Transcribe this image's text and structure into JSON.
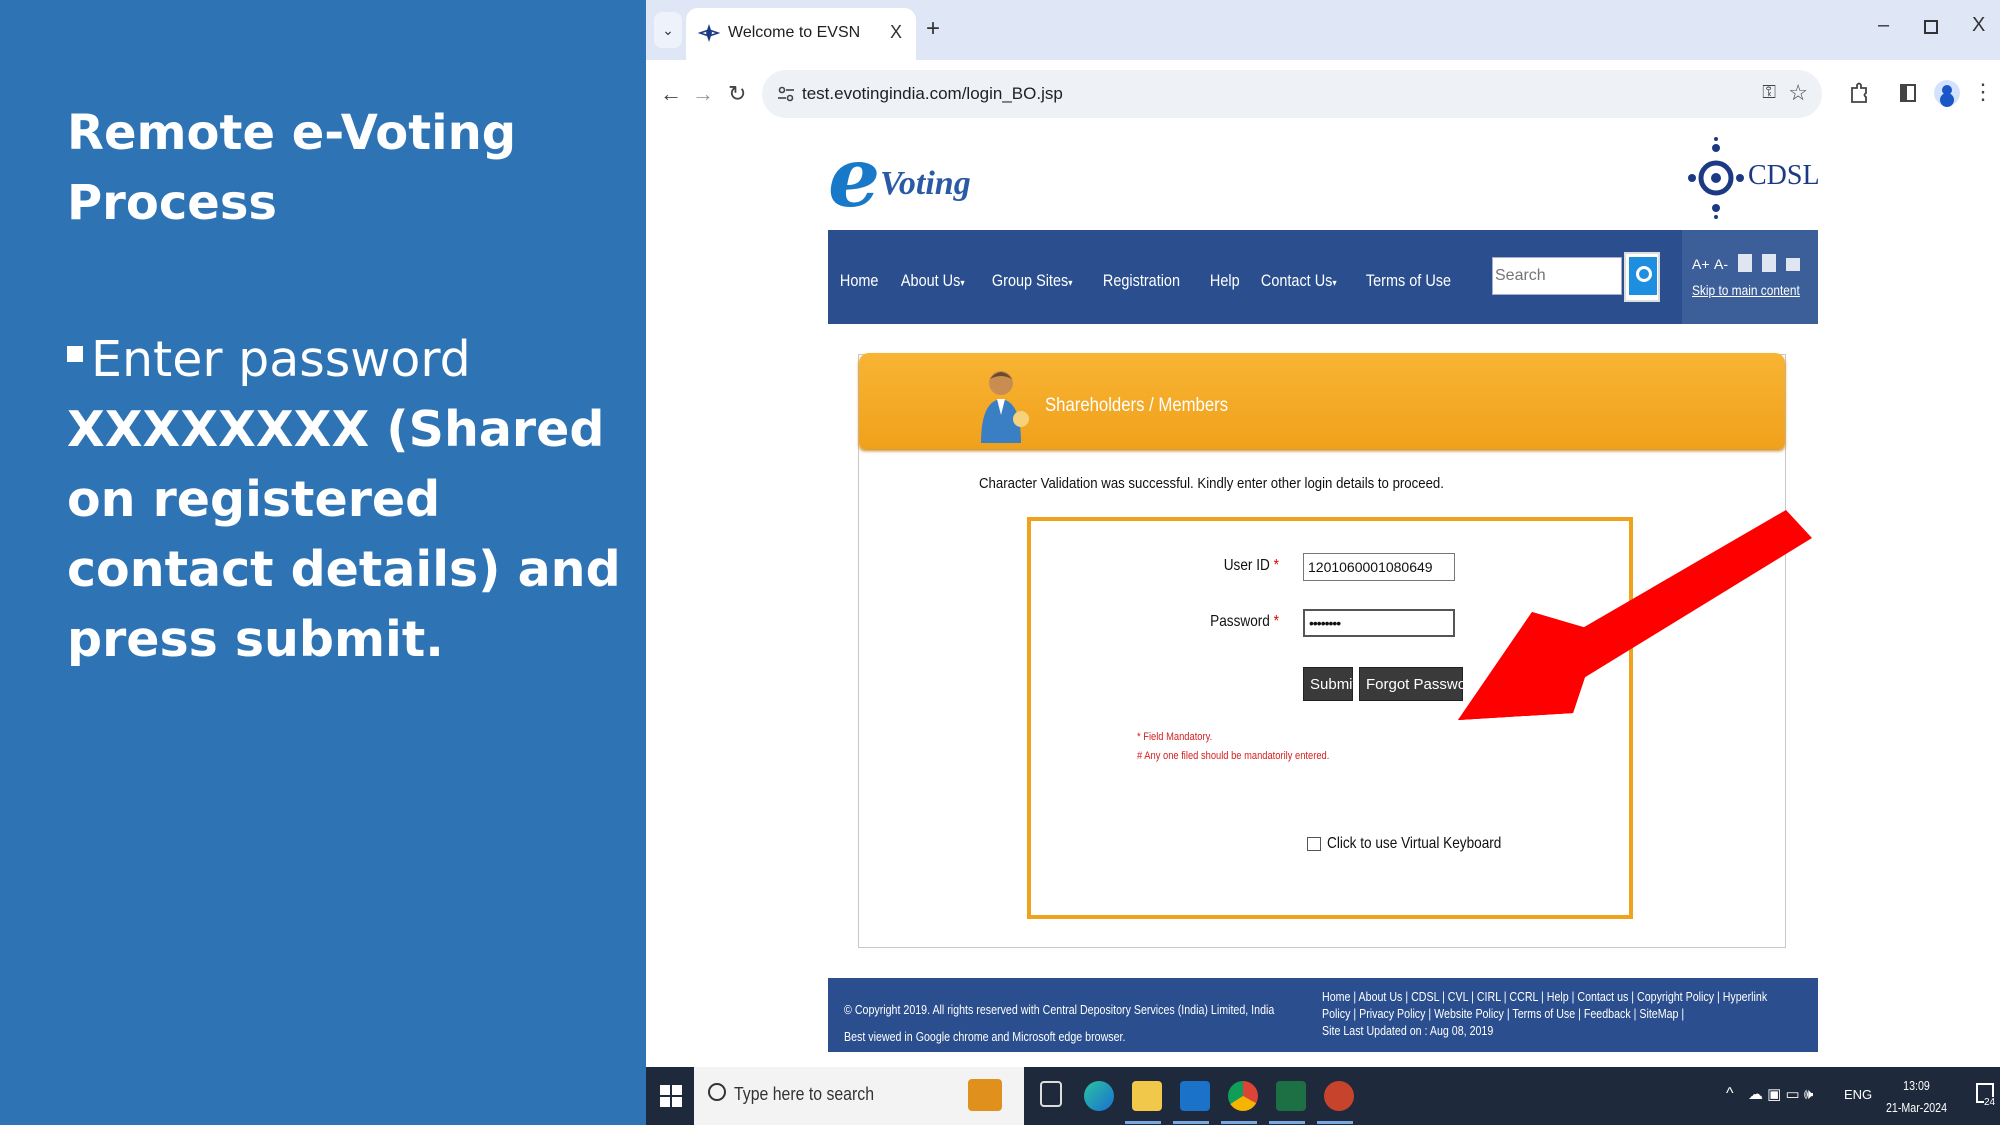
{
  "slide": {
    "title": "Remote e-Voting Process",
    "bullet_lead": "Enter password ",
    "bullet_bold": "XXXXXXXX (Shared on registered contact details) and press submit."
  },
  "browser": {
    "tab_title": "Welcome to EVSN",
    "tab_close": "X",
    "new_tab": "+",
    "url": "test.evotingindia.com/login_BO.jsp",
    "window_controls": {
      "minimize": "–",
      "close": "X"
    }
  },
  "site": {
    "logo_text": "Voting",
    "cdsl_text": "CDSL",
    "nav": [
      {
        "label": "Home",
        "dropdown": false
      },
      {
        "label": "About Us",
        "dropdown": true
      },
      {
        "label": "Group Sites",
        "dropdown": true
      },
      {
        "label": "Registration",
        "dropdown": false
      },
      {
        "label": "Help",
        "dropdown": false
      },
      {
        "label": "Contact Us",
        "dropdown": true
      },
      {
        "label": "Terms of Use",
        "dropdown": false
      }
    ],
    "search_placeholder": "Search",
    "font_increase": "A+",
    "font_decrease": "A-",
    "skip_link": "Skip to main content"
  },
  "login": {
    "header": "Shareholders / Members",
    "message": "Character Validation was successful. Kindly enter other login details to proceed.",
    "userid_label": "User ID",
    "userid_value": "1201060001080649",
    "password_label": "Password",
    "password_value": "••••••••",
    "required_mark": "*",
    "submit": "Submit",
    "forgot": "Forgot Password",
    "note_mandatory": "* Field Mandatory.",
    "note_anyone": "# Any one filed should be mandatorily entered.",
    "virtual_keyboard": "Click to use Virtual Keyboard"
  },
  "footer": {
    "copyright": "© Copyright 2019. All rights reserved with Central Depository Services (India) Limited, India",
    "browser_note": "Best viewed in Google chrome and Microsoft edge browser.",
    "links": "Home | About Us | CDSL | CVL | CIRL | CCRL | Help | Contact us | Copyright Policy | Hyperlink Policy | Privacy Policy | Website Policy | Terms of Use | Feedback | SiteMap |",
    "updated": "Site Last Updated on : Aug 08, 2019"
  },
  "taskbar": {
    "search_placeholder": "Type here to search",
    "lang": "ENG",
    "time": "13:09",
    "date": "21-Mar-2024",
    "notifications": "24"
  },
  "colors": {
    "slide_bg": "#2e74b5",
    "nav_bg": "#2a4e8e",
    "accent_orange": "#f0a21c",
    "arrow_red": "#ff0000"
  }
}
